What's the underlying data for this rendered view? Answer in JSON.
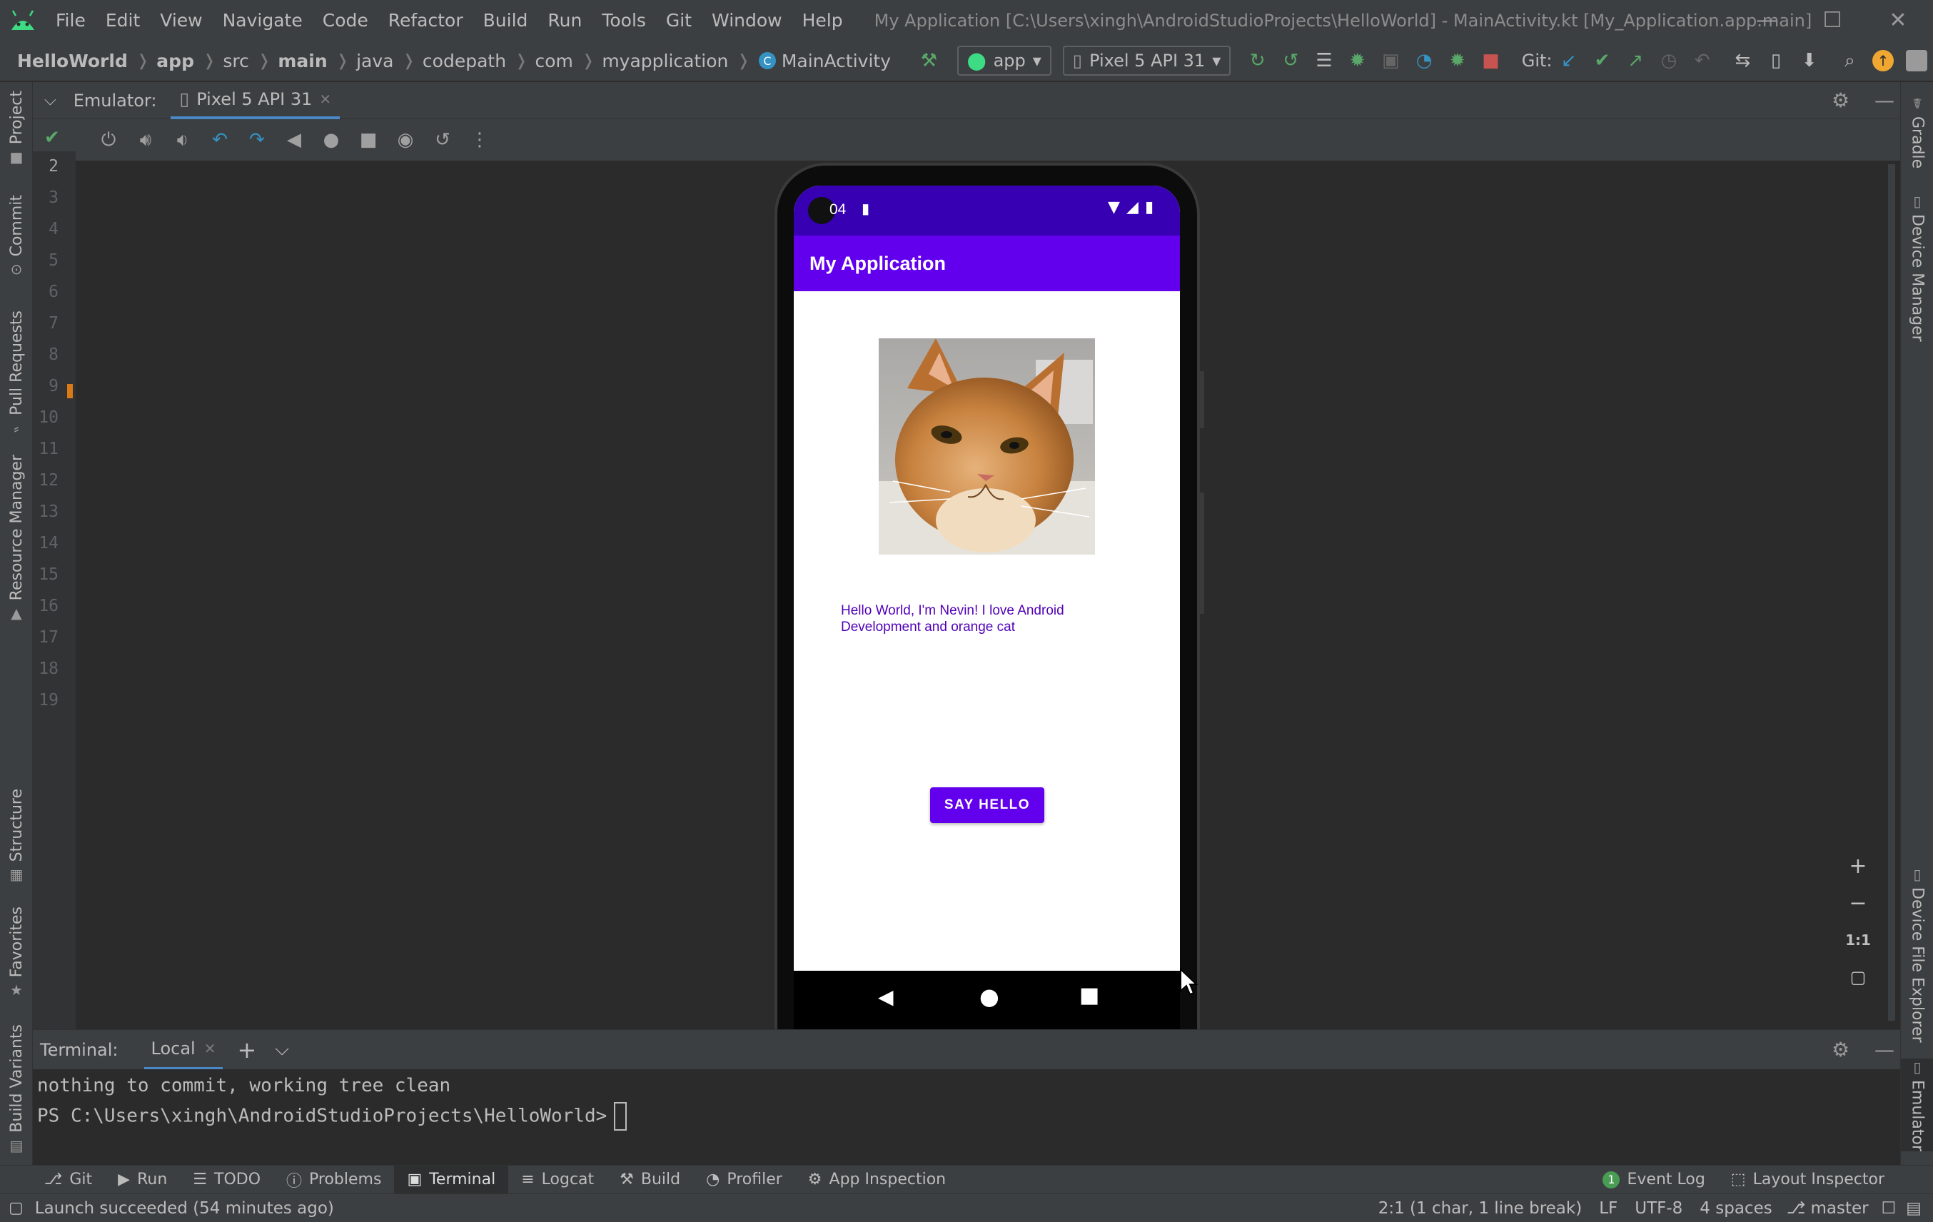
{
  "menu": {
    "items": [
      {
        "label": "File"
      },
      {
        "label": "Edit"
      },
      {
        "label": "View"
      },
      {
        "label": "Navigate"
      },
      {
        "label": "Code"
      },
      {
        "label": "Refactor"
      },
      {
        "label": "Build"
      },
      {
        "label": "Run"
      },
      {
        "label": "Tools"
      },
      {
        "label": "Git"
      },
      {
        "label": "Window"
      },
      {
        "label": "Help"
      }
    ],
    "window_title": "My Application [C:\\Users\\xingh\\AndroidStudioProjects\\HelloWorld] - MainActivity.kt [My_Application.app.main]"
  },
  "breadcrumb": {
    "items": [
      "HelloWorld",
      "app",
      "src",
      "main",
      "java",
      "codepath",
      "com",
      "myapplication",
      "MainActivity"
    ]
  },
  "toolbar": {
    "run_config": "app",
    "device": "Pixel 5 API 31",
    "git_label": "Git:"
  },
  "left_stripe": {
    "tabs": [
      "Project",
      "Commit",
      "Pull Requests",
      "Resource Manager",
      "Structure",
      "Favorites",
      "Build Variants"
    ]
  },
  "right_stripe": {
    "tabs": [
      "Gradle",
      "Device Manager",
      "Device File Explorer",
      "Emulator"
    ]
  },
  "emulator": {
    "label": "Emulator:",
    "tab": "Pixel 5 API 31",
    "zoom_ratio_label": "1:1"
  },
  "gutter": {
    "lines": [
      "2",
      "3",
      "4",
      "5",
      "6",
      "7",
      "8",
      "9",
      "10",
      "11",
      "12",
      "13",
      "14",
      "15",
      "16",
      "17",
      "18",
      "19"
    ]
  },
  "phone": {
    "status_time": "04",
    "app_title": "My Application",
    "hello_text": "Hello World, I'm Nevin! I love Android Development and orange cat",
    "button_label": "SAY HELLO",
    "colors": {
      "status": "#3700b3",
      "appbar": "#6200ee",
      "text": "#5200b8"
    }
  },
  "terminal": {
    "label": "Terminal:",
    "tab": "Local",
    "lines": [
      "nothing to commit, working tree clean",
      "PS C:\\Users\\xingh\\AndroidStudioProjects\\HelloWorld>"
    ]
  },
  "tool_windows": {
    "left": [
      "Git",
      "Run",
      "TODO",
      "Problems",
      "Terminal",
      "Logcat",
      "Build",
      "Profiler",
      "App Inspection"
    ],
    "event_log_count": "1",
    "event_log": "Event Log",
    "layout_inspector": "Layout Inspector"
  },
  "status": {
    "message": "Launch succeeded (54 minutes ago)",
    "position": "2:1 (1 char, 1 line break)",
    "line_sep": "LF",
    "encoding": "UTF-8",
    "indent": "4 spaces",
    "branch": "master"
  }
}
